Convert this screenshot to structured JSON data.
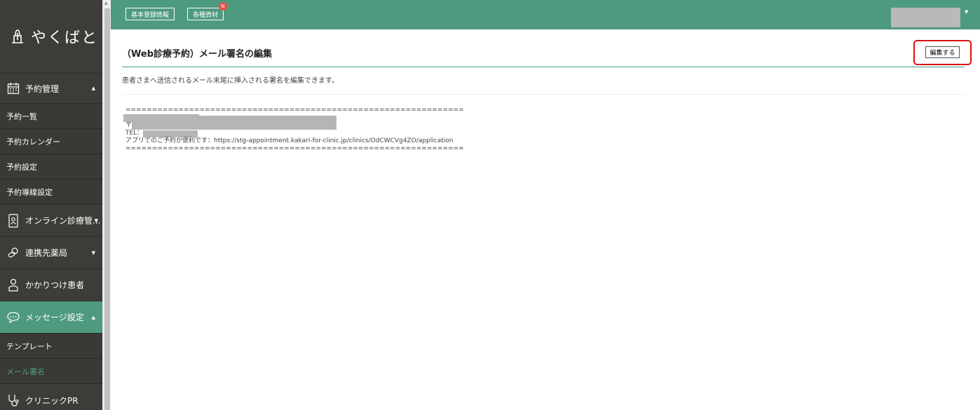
{
  "app": {
    "logo_text": "やくばと"
  },
  "sidebar": {
    "items": [
      {
        "label": "予約管理",
        "icon": "calendar-icon"
      },
      {
        "label": "予約一覧"
      },
      {
        "label": "予約カレンダー"
      },
      {
        "label": "予約設定"
      },
      {
        "label": "予約導線設定"
      },
      {
        "label": "オンライン診療管...",
        "icon": "smartphone-person-icon"
      },
      {
        "label": "連携先薬局",
        "icon": "pharmacy-pills-icon"
      },
      {
        "label": "かかりつけ患者",
        "icon": "person-icon"
      },
      {
        "label": "メッセージ設定",
        "icon": "chat-bubble-icon"
      },
      {
        "label": "テンプレート"
      },
      {
        "label": "メール署名"
      },
      {
        "label": "クリニックPR",
        "icon": "stethoscope-icon"
      }
    ]
  },
  "topbar": {
    "basic_info_label": "基本登録情報",
    "materials_label": "各種資材",
    "new_badge": "N"
  },
  "main": {
    "title": "（Web診療予約）メール署名の編集",
    "edit_button": "編集する",
    "description": "患者さまへ送信されるメール末尾に挿入される署名を編集できます。",
    "signature": {
      "separator": "================================================================",
      "postal_prefix": "〒",
      "tel_prefix": "TEL：",
      "app_line": "アプリでのご予約が便利です：https://stg-appointment.kakari-for-clinic.jp/clinics/OdCWCVg4ZO/application"
    }
  },
  "colors": {
    "accent": "#4e9a7e",
    "sidebar_bg": "#3c3d38",
    "highlight": "#dd1111"
  }
}
